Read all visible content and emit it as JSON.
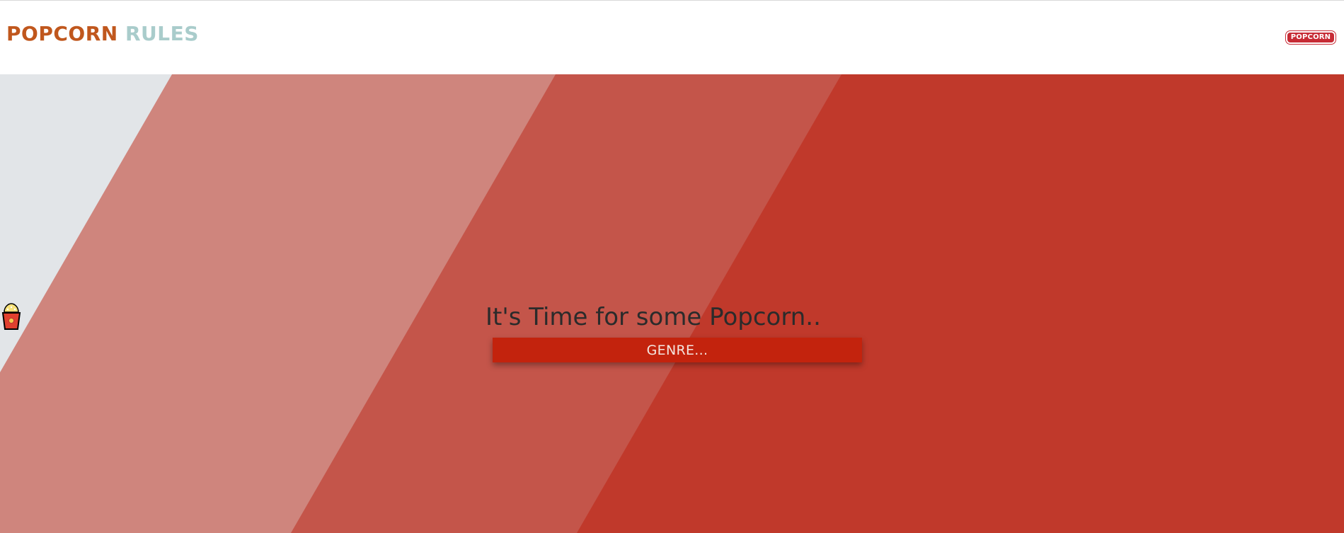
{
  "header": {
    "brand_word1": "POPCORN",
    "brand_word2": "RULES",
    "logo_text": "POPCORN"
  },
  "hero": {
    "tagline": "It's Time for some Popcorn..",
    "tagline_icon": "popcorn-bucket-icon",
    "genre_button_label": "GENRE..."
  },
  "colors": {
    "brand_primary": "#c0571d",
    "brand_secondary": "#a9cccb",
    "logo_red": "#c72b35",
    "stripe_grey": "#e2e5e8",
    "stripe_light": "#cf857d",
    "stripe_mid": "#c4554a",
    "stripe_dark": "#c0392b",
    "button_red": "#c3230d",
    "text_dark": "#2b2b2b"
  }
}
